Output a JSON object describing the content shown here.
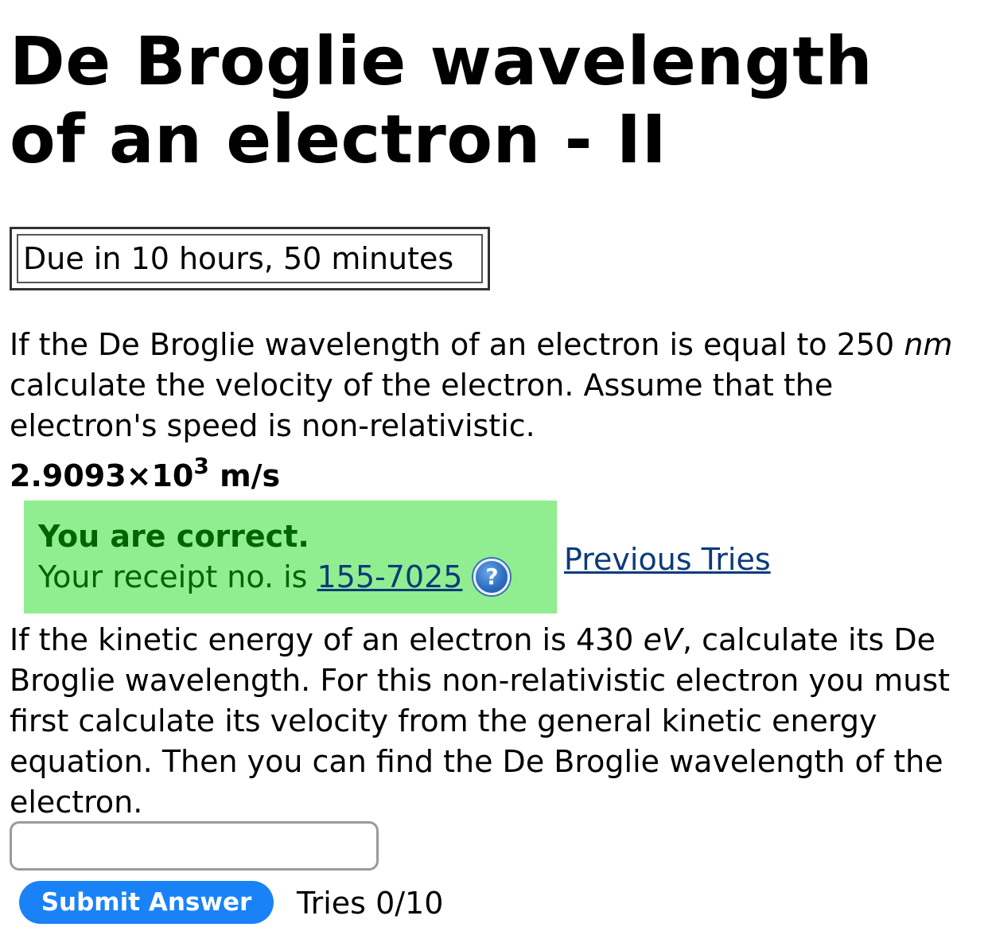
{
  "page": {
    "title": "De Broglie wavelength of an electron - II",
    "due": "Due in 10 hours, 50 minutes"
  },
  "question1": {
    "text_before_unit": "If the De Broglie wavelength of an electron is equal to 250 ",
    "unit": "nm",
    "text_after_unit": " calculate the velocity of the electron. Assume that the electron's speed is non-relativistic.",
    "answer_mantissa": "2.9093×10",
    "answer_exponent": "3",
    "answer_unit": " m/s",
    "feedback_title": "You are correct.",
    "receipt_label": "Your receipt no. is",
    "receipt_number": "155-7025",
    "help_icon": "help-icon",
    "previous_tries_label": "Previous Tries"
  },
  "question2": {
    "text_before_unit": "If the kinetic energy of an electron is 430 ",
    "unit": "eV",
    "text_after_unit": ", calculate its De Broglie wavelength. For this non-relativistic electron you must first calculate its velocity from the general kinetic energy equation. Then you can find the De Broglie wavelength of the electron.",
    "input_value": "",
    "submit_label": "Submit Answer",
    "tries": "Tries 0/10"
  },
  "colors": {
    "feedback_bg": "#90ee90",
    "feedback_text": "#006400",
    "link": "#0b3b7a",
    "submit_bg": "#1a82f7"
  }
}
